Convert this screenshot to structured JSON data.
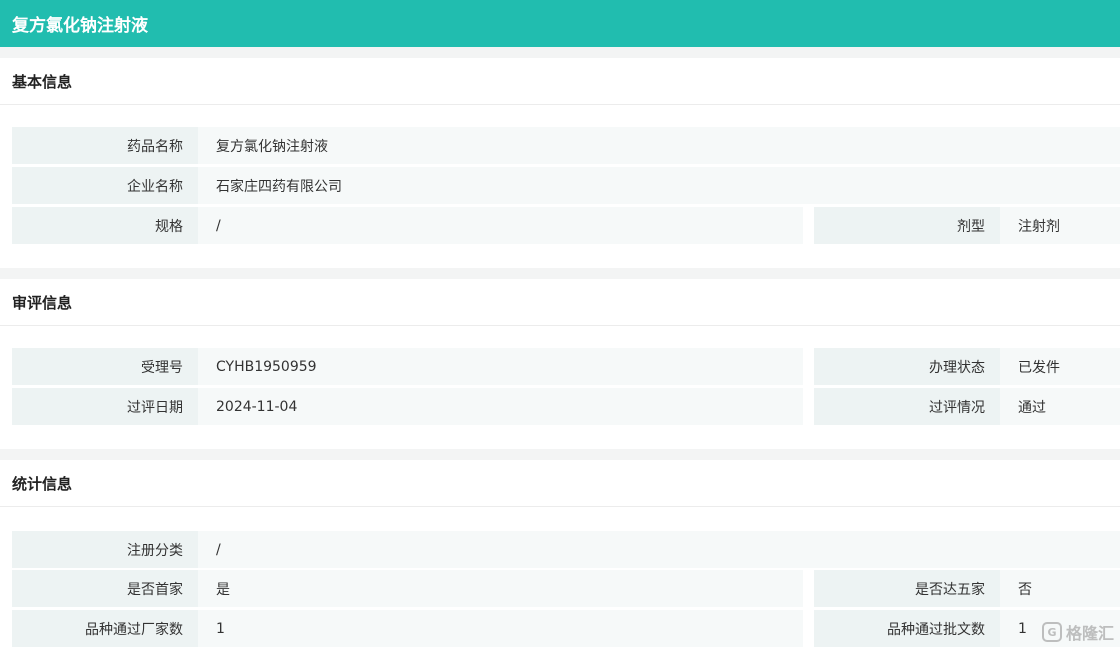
{
  "title": "复方氯化钠注射液",
  "sections": {
    "basic": {
      "heading": "基本信息",
      "drug_name_label": "药品名称",
      "drug_name_value": "复方氯化钠注射液",
      "company_label": "企业名称",
      "company_value": "石家庄四药有限公司",
      "spec_label": "规格",
      "spec_value": "/",
      "form_label": "剂型",
      "form_value": "注射剂"
    },
    "review": {
      "heading": "审评信息",
      "accept_no_label": "受理号",
      "accept_no_value": "CYHB1950959",
      "status_label": "办理状态",
      "status_value": "已发件",
      "date_label": "过评日期",
      "date_value": "2024-11-04",
      "result_label": "过评情况",
      "result_value": "通过"
    },
    "stats": {
      "heading": "统计信息",
      "reg_class_label": "注册分类",
      "reg_class_value": "/",
      "first_label": "是否首家",
      "first_value": "是",
      "five_label": "是否达五家",
      "five_value": "否",
      "makers_label": "品种通过厂家数",
      "makers_value": "1",
      "approvals_label": "品种通过批文数",
      "approvals_value": "1"
    }
  },
  "watermark": {
    "text": "格隆汇",
    "logo_glyph": "G"
  },
  "colors": {
    "accent": "#21bdaf",
    "label_bg": "#edf3f3",
    "value_bg": "#f6f9f9"
  }
}
